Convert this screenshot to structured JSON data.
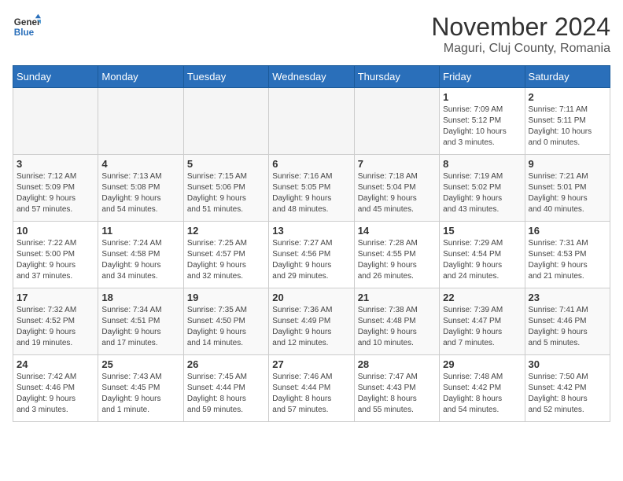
{
  "logo": {
    "line1": "General",
    "line2": "Blue"
  },
  "title": "November 2024",
  "location": "Maguri, Cluj County, Romania",
  "days_of_week": [
    "Sunday",
    "Monday",
    "Tuesday",
    "Wednesday",
    "Thursday",
    "Friday",
    "Saturday"
  ],
  "weeks": [
    [
      {
        "day": "",
        "info": ""
      },
      {
        "day": "",
        "info": ""
      },
      {
        "day": "",
        "info": ""
      },
      {
        "day": "",
        "info": ""
      },
      {
        "day": "",
        "info": ""
      },
      {
        "day": "1",
        "info": "Sunrise: 7:09 AM\nSunset: 5:12 PM\nDaylight: 10 hours\nand 3 minutes."
      },
      {
        "day": "2",
        "info": "Sunrise: 7:11 AM\nSunset: 5:11 PM\nDaylight: 10 hours\nand 0 minutes."
      }
    ],
    [
      {
        "day": "3",
        "info": "Sunrise: 7:12 AM\nSunset: 5:09 PM\nDaylight: 9 hours\nand 57 minutes."
      },
      {
        "day": "4",
        "info": "Sunrise: 7:13 AM\nSunset: 5:08 PM\nDaylight: 9 hours\nand 54 minutes."
      },
      {
        "day": "5",
        "info": "Sunrise: 7:15 AM\nSunset: 5:06 PM\nDaylight: 9 hours\nand 51 minutes."
      },
      {
        "day": "6",
        "info": "Sunrise: 7:16 AM\nSunset: 5:05 PM\nDaylight: 9 hours\nand 48 minutes."
      },
      {
        "day": "7",
        "info": "Sunrise: 7:18 AM\nSunset: 5:04 PM\nDaylight: 9 hours\nand 45 minutes."
      },
      {
        "day": "8",
        "info": "Sunrise: 7:19 AM\nSunset: 5:02 PM\nDaylight: 9 hours\nand 43 minutes."
      },
      {
        "day": "9",
        "info": "Sunrise: 7:21 AM\nSunset: 5:01 PM\nDaylight: 9 hours\nand 40 minutes."
      }
    ],
    [
      {
        "day": "10",
        "info": "Sunrise: 7:22 AM\nSunset: 5:00 PM\nDaylight: 9 hours\nand 37 minutes."
      },
      {
        "day": "11",
        "info": "Sunrise: 7:24 AM\nSunset: 4:58 PM\nDaylight: 9 hours\nand 34 minutes."
      },
      {
        "day": "12",
        "info": "Sunrise: 7:25 AM\nSunset: 4:57 PM\nDaylight: 9 hours\nand 32 minutes."
      },
      {
        "day": "13",
        "info": "Sunrise: 7:27 AM\nSunset: 4:56 PM\nDaylight: 9 hours\nand 29 minutes."
      },
      {
        "day": "14",
        "info": "Sunrise: 7:28 AM\nSunset: 4:55 PM\nDaylight: 9 hours\nand 26 minutes."
      },
      {
        "day": "15",
        "info": "Sunrise: 7:29 AM\nSunset: 4:54 PM\nDaylight: 9 hours\nand 24 minutes."
      },
      {
        "day": "16",
        "info": "Sunrise: 7:31 AM\nSunset: 4:53 PM\nDaylight: 9 hours\nand 21 minutes."
      }
    ],
    [
      {
        "day": "17",
        "info": "Sunrise: 7:32 AM\nSunset: 4:52 PM\nDaylight: 9 hours\nand 19 minutes."
      },
      {
        "day": "18",
        "info": "Sunrise: 7:34 AM\nSunset: 4:51 PM\nDaylight: 9 hours\nand 17 minutes."
      },
      {
        "day": "19",
        "info": "Sunrise: 7:35 AM\nSunset: 4:50 PM\nDaylight: 9 hours\nand 14 minutes."
      },
      {
        "day": "20",
        "info": "Sunrise: 7:36 AM\nSunset: 4:49 PM\nDaylight: 9 hours\nand 12 minutes."
      },
      {
        "day": "21",
        "info": "Sunrise: 7:38 AM\nSunset: 4:48 PM\nDaylight: 9 hours\nand 10 minutes."
      },
      {
        "day": "22",
        "info": "Sunrise: 7:39 AM\nSunset: 4:47 PM\nDaylight: 9 hours\nand 7 minutes."
      },
      {
        "day": "23",
        "info": "Sunrise: 7:41 AM\nSunset: 4:46 PM\nDaylight: 9 hours\nand 5 minutes."
      }
    ],
    [
      {
        "day": "24",
        "info": "Sunrise: 7:42 AM\nSunset: 4:46 PM\nDaylight: 9 hours\nand 3 minutes."
      },
      {
        "day": "25",
        "info": "Sunrise: 7:43 AM\nSunset: 4:45 PM\nDaylight: 9 hours\nand 1 minute."
      },
      {
        "day": "26",
        "info": "Sunrise: 7:45 AM\nSunset: 4:44 PM\nDaylight: 8 hours\nand 59 minutes."
      },
      {
        "day": "27",
        "info": "Sunrise: 7:46 AM\nSunset: 4:44 PM\nDaylight: 8 hours\nand 57 minutes."
      },
      {
        "day": "28",
        "info": "Sunrise: 7:47 AM\nSunset: 4:43 PM\nDaylight: 8 hours\nand 55 minutes."
      },
      {
        "day": "29",
        "info": "Sunrise: 7:48 AM\nSunset: 4:42 PM\nDaylight: 8 hours\nand 54 minutes."
      },
      {
        "day": "30",
        "info": "Sunrise: 7:50 AM\nSunset: 4:42 PM\nDaylight: 8 hours\nand 52 minutes."
      }
    ]
  ]
}
